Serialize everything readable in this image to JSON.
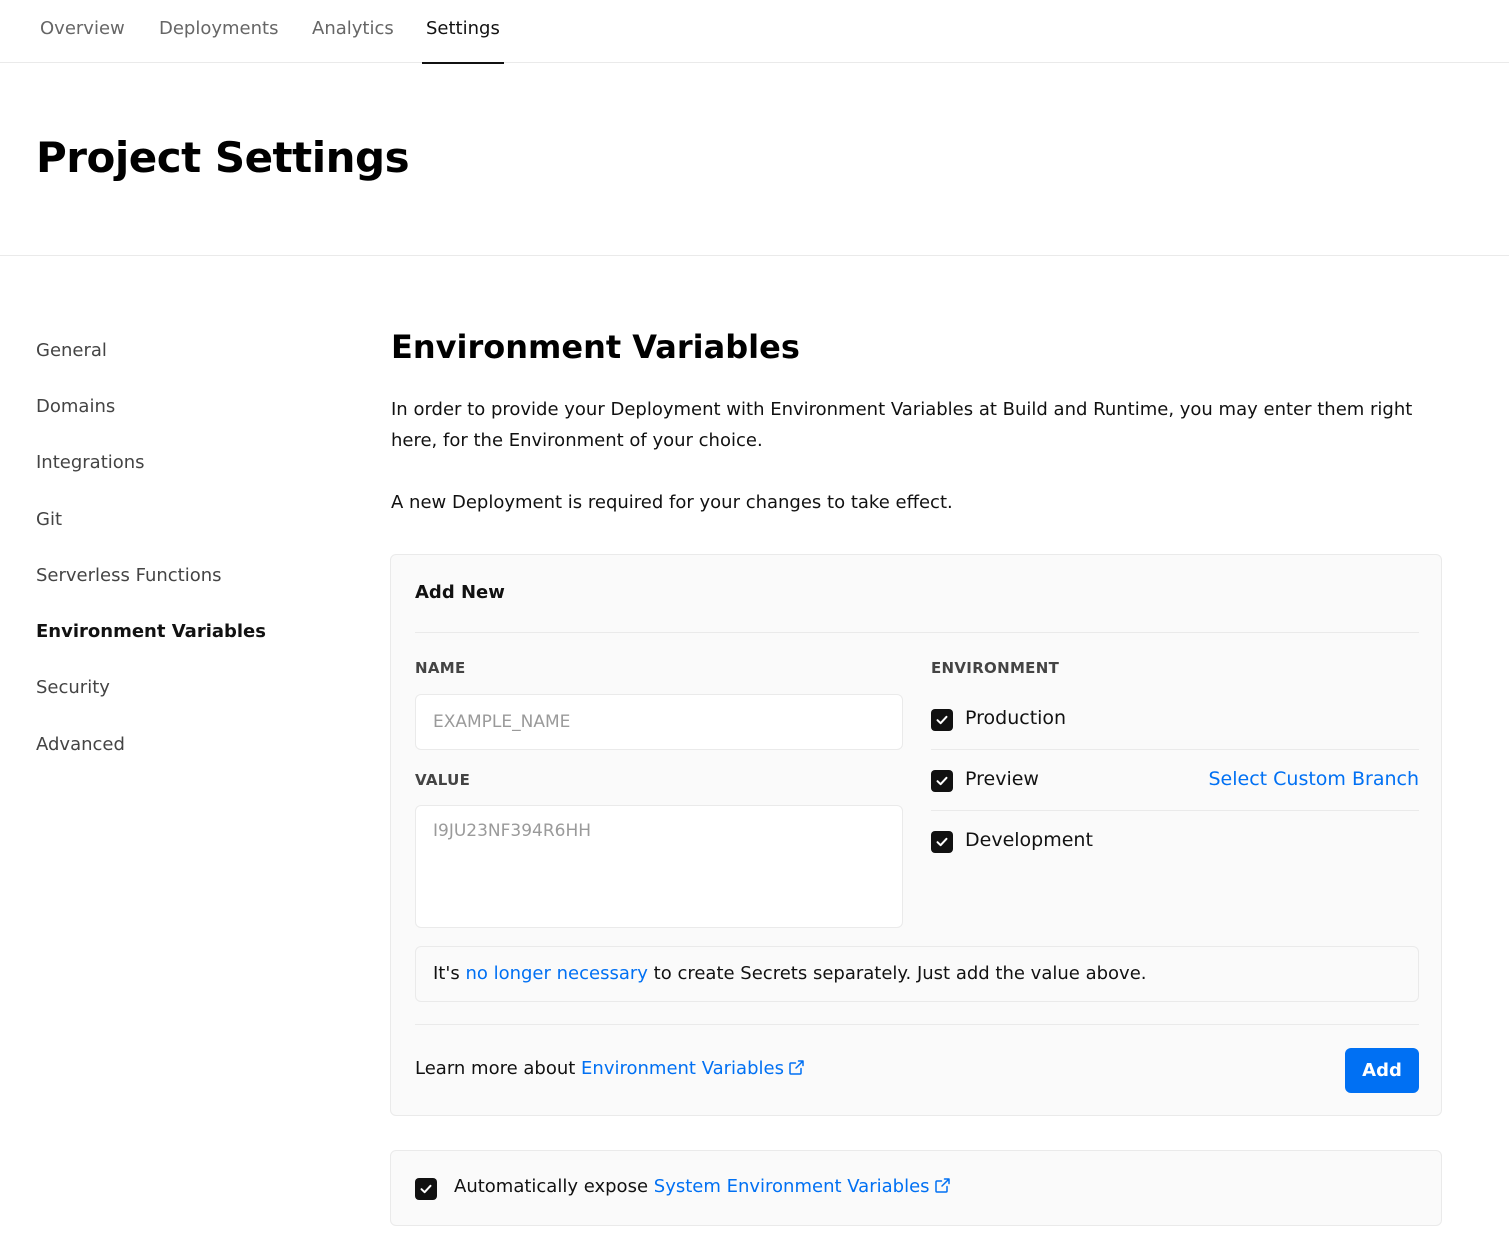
{
  "nav": {
    "tabs": [
      {
        "label": "Overview"
      },
      {
        "label": "Deployments"
      },
      {
        "label": "Analytics"
      },
      {
        "label": "Settings"
      }
    ]
  },
  "header": {
    "title": "Project Settings"
  },
  "sidebar": {
    "items": [
      {
        "label": "General"
      },
      {
        "label": "Domains"
      },
      {
        "label": "Integrations"
      },
      {
        "label": "Git"
      },
      {
        "label": "Serverless Functions"
      },
      {
        "label": "Environment Variables"
      },
      {
        "label": "Security"
      },
      {
        "label": "Advanced"
      }
    ],
    "active": "Environment Variables"
  },
  "main": {
    "title": "Environment Variables",
    "description": "In order to provide your Deployment with Environment Variables at Build and Runtime, you may enter them right here, for the Environment of your choice.",
    "notice": "A new Deployment is required for your changes to take effect.",
    "add_new": {
      "title": "Add New",
      "name_label": "NAME",
      "name_placeholder": "EXAMPLE_NAME",
      "name_value": "",
      "value_label": "VALUE",
      "value_placeholder": "I9JU23NF394R6HH",
      "value_value": "",
      "environment_label": "ENVIRONMENT",
      "environments": [
        {
          "label": "Production",
          "checked": true
        },
        {
          "label": "Preview",
          "checked": true
        },
        {
          "label": "Development",
          "checked": true
        }
      ],
      "custom_branch_link": "Select Custom Branch",
      "secrets_note": {
        "prefix": "It's",
        "link": "no longer necessary",
        "suffix": "to create Secrets separately. Just add the value above."
      },
      "learn_more": {
        "prefix": "Learn more about",
        "link": "Environment Variables"
      },
      "add_button": "Add"
    },
    "system_vars": {
      "checked": true,
      "prefix": "Automatically expose",
      "link": "System Environment Variables"
    }
  },
  "colors": {
    "accent": "#0070f3",
    "text": "#111111",
    "muted": "#666666",
    "border": "#eaeaea",
    "card_bg": "#fafafa"
  }
}
